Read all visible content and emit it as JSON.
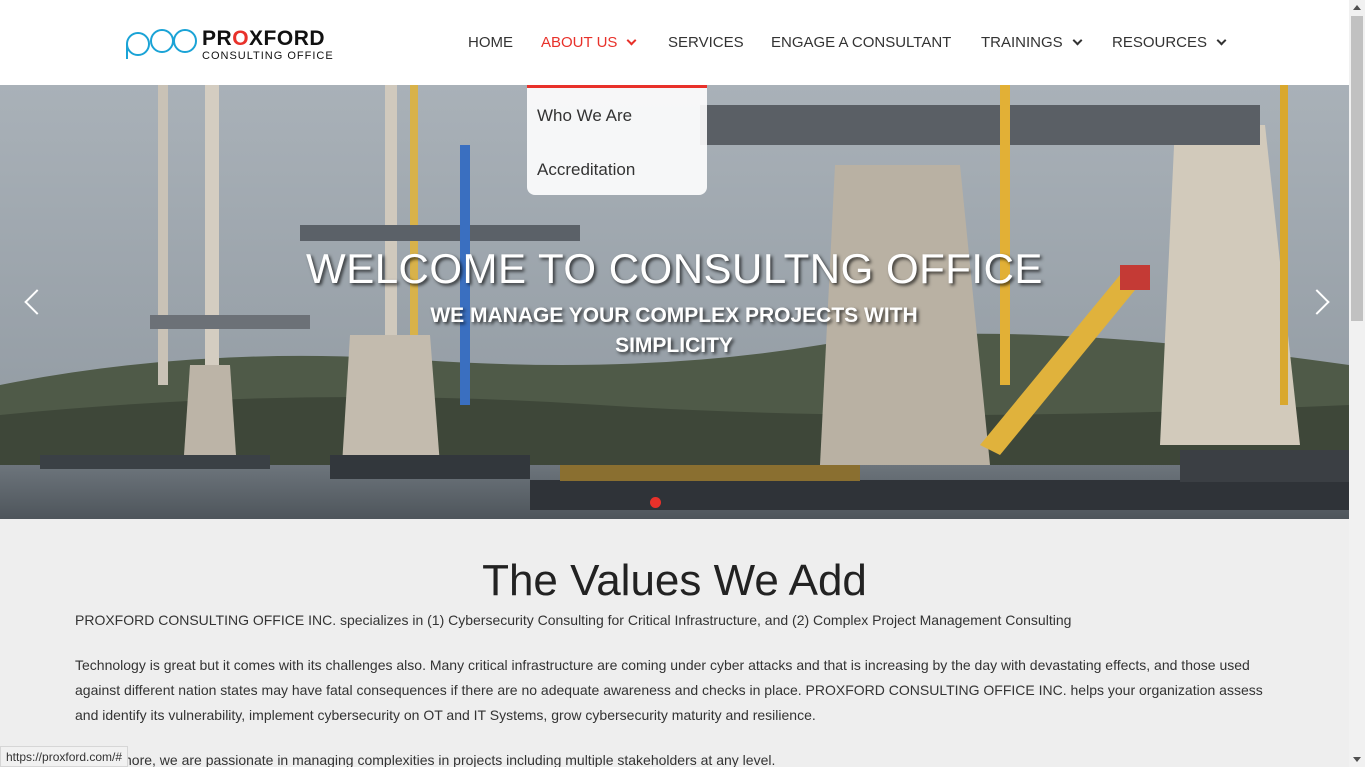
{
  "logo": {
    "brand_prefix": "PR",
    "brand_o": "O",
    "brand_suffix": "XFORD",
    "tagline": "CONSULTING OFFICE"
  },
  "nav": {
    "items": [
      {
        "label": "HOME"
      },
      {
        "label": "ABOUT US",
        "active": true
      },
      {
        "label": "SERVICES"
      },
      {
        "label": "ENGAGE A CONSULTANT"
      },
      {
        "label": "TRAININGS"
      },
      {
        "label": "RESOURCES"
      }
    ]
  },
  "dropdown": {
    "items": [
      {
        "label": "Who We Are"
      },
      {
        "label": "Accreditation"
      }
    ]
  },
  "hero": {
    "title": "WELCOME TO CONSULTNG OFFICE",
    "subtitle": "WE MANAGE YOUR COMPLEX PROJECTS WITH SIMPLICITY"
  },
  "values": {
    "title": "The Values We Add",
    "para1": "PROXFORD CONSULTING OFFICE INC. specializes in (1) Cybersecurity Consulting for Critical Infrastructure, and (2) Complex Project Management Consulting",
    "para2": "Technology is great but it comes with its challenges also. Many critical infrastructure are coming under cyber attacks and that is increasing by the day with devastating effects, and those used against different nation states may have fatal consequences if there are no adequate awareness and checks in place. PROXFORD CONSULTING OFFICE INC. helps your organization assess and identify its vulnerability, implement cybersecurity on OT and IT Systems, grow cybersecurity maturity and resilience.",
    "para3": "Furthermore, we are passionate in managing  complexities in projects including multiple stakeholders at any level."
  },
  "status_url": "https://proxford.com/#",
  "colors": {
    "accent": "#e8312a",
    "logo_blue": "#1aa3d6",
    "text": "#333333",
    "background": "#eeeeee"
  }
}
